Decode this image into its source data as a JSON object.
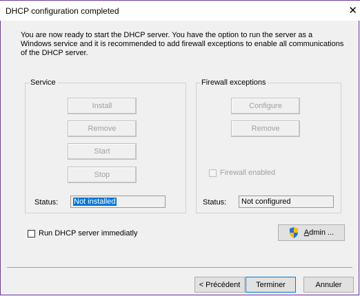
{
  "window": {
    "title": "DHCP configuration completed",
    "close_glyph": "✕"
  },
  "intro": "You are now ready to start the DHCP server. You have the option to run the server as a Windows service and it is recommended to add firewall exceptions to enable all communications of the DHCP server.",
  "service": {
    "group_label": "Service",
    "buttons": {
      "install": "Install",
      "remove": "Remove",
      "start": "Start",
      "stop": "Stop"
    },
    "status_label": "Status:",
    "status_value": "Not installed"
  },
  "firewall": {
    "group_label": "Firewall exceptions",
    "buttons": {
      "configure": "Configure",
      "remove": "Remove"
    },
    "enabled_label": "Firewall enabled",
    "enabled_checked": false,
    "status_label": "Status:",
    "status_value": "Not configured"
  },
  "run_immediately": {
    "label": "Run DHCP server immediatly",
    "checked": false
  },
  "admin_button": {
    "accesskey": "A",
    "rest": "dmin ...",
    "icon": "shield-icon"
  },
  "footer": {
    "previous": "< Précédent",
    "finish": "Terminer",
    "cancel": "Annuler"
  },
  "colors": {
    "selection": "#0078d7",
    "window_border": "#6b3fa0",
    "default_button_border": "#0078d7"
  }
}
